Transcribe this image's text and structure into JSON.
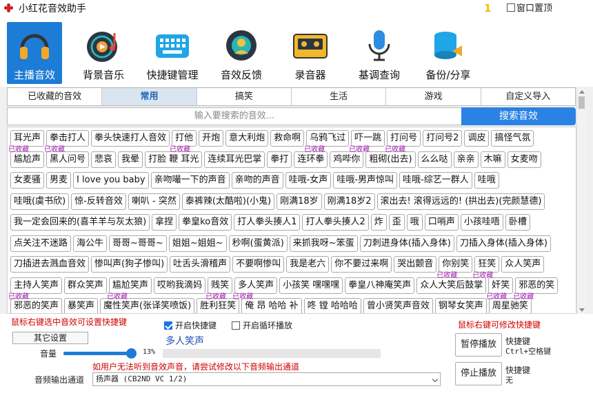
{
  "app": {
    "title": "小红花音效助手",
    "mini_mark": "1",
    "topmost_label": "窗口置顶"
  },
  "toolbar": [
    {
      "label": "主播音效",
      "icon": "headphones-icon",
      "active": true
    },
    {
      "label": "背景音乐",
      "icon": "music-disc-icon",
      "active": false
    },
    {
      "label": "快捷键管理",
      "icon": "keyboard-icon",
      "active": false
    },
    {
      "label": "音效反馈",
      "icon": "feedback-icon",
      "active": false
    },
    {
      "label": "录音器",
      "icon": "cassette-icon",
      "active": false
    },
    {
      "label": "基调查询",
      "icon": "microphone-icon",
      "active": false
    },
    {
      "label": "备份/分享",
      "icon": "database-share-icon",
      "active": false
    }
  ],
  "tabs": [
    "已收藏的音效",
    "常用",
    "搞笑",
    "生活",
    "游戏",
    "自定义导入"
  ],
  "active_tab": 1,
  "search": {
    "placeholder": "输入要搜索的音效...",
    "button": "搜索音效"
  },
  "fav_label": "已收藏",
  "sound_rows": [
    [
      {
        "t": "耳光声",
        "f": true
      },
      {
        "t": "拳击打人",
        "f": true
      },
      {
        "t": "拳头快速打人音效",
        "f": false
      },
      {
        "t": "打他",
        "f": true
      },
      {
        "t": "开炮",
        "f": false
      },
      {
        "t": "意大利炮",
        "f": false
      },
      {
        "t": "救命啊",
        "f": false
      },
      {
        "t": "乌鸦飞过",
        "f": true
      },
      {
        "t": "吓一跳",
        "f": true
      },
      {
        "t": "打问号",
        "f": true
      },
      {
        "t": "打问号2",
        "f": false
      },
      {
        "t": "调皮",
        "f": false
      },
      {
        "t": "搞怪气氛",
        "f": false
      }
    ],
    [
      {
        "t": "尴尬声",
        "f": false
      },
      {
        "t": "黑人问号",
        "f": false
      },
      {
        "t": "悲哀",
        "f": false
      },
      {
        "t": "我晕",
        "f": false
      },
      {
        "t": "打脸 鞭 耳光",
        "f": false
      },
      {
        "t": "连续耳光巴掌",
        "f": false
      },
      {
        "t": "拳打",
        "f": false
      },
      {
        "t": "连环拳",
        "f": false
      },
      {
        "t": "鸡哔你",
        "f": false
      },
      {
        "t": "粗砌(出去)",
        "f": false
      },
      {
        "t": "么么哒",
        "f": false
      },
      {
        "t": "亲亲",
        "f": false
      },
      {
        "t": "木嘛",
        "f": false
      },
      {
        "t": "女麦吻",
        "f": false
      }
    ],
    [
      {
        "t": "女麦骚",
        "f": false
      },
      {
        "t": "男麦",
        "f": false
      },
      {
        "t": "I love you baby",
        "f": false
      },
      {
        "t": "亲吻嘬一下的声音",
        "f": false
      },
      {
        "t": "亲吻的声音",
        "f": false
      },
      {
        "t": "哇哦-女声",
        "f": false
      },
      {
        "t": "哇哦-男声惊叫",
        "f": false
      },
      {
        "t": "哇哦-综艺一群人",
        "f": false
      },
      {
        "t": "哇哦",
        "f": false
      }
    ],
    [
      {
        "t": "哇哦(虞书欣)",
        "f": false
      },
      {
        "t": "惊-反转音效",
        "f": false
      },
      {
        "t": "喇叭 - 突然",
        "f": false
      },
      {
        "t": "泰裤辣(太酷啦)(小鬼)",
        "f": false
      },
      {
        "t": "刚满18岁",
        "f": false
      },
      {
        "t": "刚满18岁2",
        "f": false
      },
      {
        "t": "滚出去! 滚得远远的! (拱出去)(完颜慧德)",
        "f": false
      }
    ],
    [
      {
        "t": "我一定会回来的(喜羊羊与灰太狼)",
        "f": false
      },
      {
        "t": "拿捏",
        "f": false
      },
      {
        "t": "拳皇ko音效",
        "f": false
      },
      {
        "t": "打人拳头揍人1",
        "f": false
      },
      {
        "t": "打人拳头揍人2",
        "f": false
      },
      {
        "t": "炸",
        "f": false
      },
      {
        "t": "歪",
        "f": false
      },
      {
        "t": "哦",
        "f": false
      },
      {
        "t": "口哨声",
        "f": false
      },
      {
        "t": "小孩哇唔",
        "f": false
      },
      {
        "t": "卧槽",
        "f": false
      }
    ],
    [
      {
        "t": "点关注不迷路",
        "f": false
      },
      {
        "t": "海公牛",
        "f": false
      },
      {
        "t": "哥哥~哥哥~",
        "f": false
      },
      {
        "t": "姐姐~姐姐~",
        "f": false
      },
      {
        "t": "秒啊(蛋黄派)",
        "f": false
      },
      {
        "t": "来抓我呀~笨蛋",
        "f": false
      },
      {
        "t": "刀刺进身体(插入身体)",
        "f": false
      },
      {
        "t": "刀插入身体(插入身体)",
        "f": false
      }
    ],
    [
      {
        "t": "刀插进去溅血音效",
        "f": false
      },
      {
        "t": "惨叫声(狗子惨叫)",
        "f": false
      },
      {
        "t": "吐舌头滑稽声",
        "f": false
      },
      {
        "t": "不要啊惨叫",
        "f": false
      },
      {
        "t": "我是老六",
        "f": false
      },
      {
        "t": "你不要过来啊",
        "f": false
      },
      {
        "t": "哭出颤音",
        "f": false
      },
      {
        "t": "你别笑",
        "f": true
      },
      {
        "t": "狂笑",
        "f": true
      },
      {
        "t": "众人笑声",
        "f": false
      }
    ],
    [
      {
        "t": "主持人笑声",
        "f": true
      },
      {
        "t": "群众笑声",
        "f": false
      },
      {
        "t": "尴尬笑声",
        "f": true
      },
      {
        "t": "哎哟我滴妈",
        "f": false
      },
      {
        "t": "贱笑",
        "f": true
      },
      {
        "t": "多人笑声",
        "f": true
      },
      {
        "t": "小孩笑 嘿嘿嘿",
        "f": false
      },
      {
        "t": "拳皇八神庵笑声",
        "f": false
      },
      {
        "t": "众人大笑后鼓掌",
        "f": false
      },
      {
        "t": "奸笑",
        "f": true
      },
      {
        "t": "邪恶的笑",
        "f": true
      }
    ],
    [
      {
        "t": "邪恶的笑声",
        "f": false
      },
      {
        "t": "暴笑声",
        "f": true
      },
      {
        "t": "魔性笑声(张译笑喷饭)",
        "f": false
      },
      {
        "t": "胜利狂笑",
        "f": true
      },
      {
        "t": "俺 昂 哈哈 补",
        "f": false
      },
      {
        "t": "咚 镗 哈哈哈",
        "f": false
      },
      {
        "t": "曾小贤笑声音效",
        "f": true
      },
      {
        "t": "钢琴女笑声",
        "f": false
      },
      {
        "t": "周星驰笑",
        "f": false
      }
    ]
  ],
  "bottom": {
    "tip_left": "鼠标右键选中音效可设置快捷键",
    "tip_right": "鼠标右键可修改快捷键",
    "other_settings": "其它设置",
    "enable_hotkey": "开启快捷键",
    "enable_hotkey_checked": true,
    "loop_play": "开启循环播放",
    "loop_play_checked": false,
    "now_playing": "多人笑声",
    "volume_label": "音量",
    "volume_value": "13%",
    "volume_fraction": 0.92,
    "playback_progress": 0,
    "output_warning": "如用户无法听到音效声音，请尝试修改以下音频输出通道",
    "output_label": "音频输出通道",
    "output_device": "扬声器 (CB2ND VC 1/2)",
    "pause_button": "暂停播放",
    "pause_hotkey_label": "快捷键",
    "pause_hotkey_value": "Ctrl+空格键",
    "stop_button": "停止播放",
    "stop_hotkey_label": "快捷键",
    "stop_hotkey_value": "无"
  }
}
